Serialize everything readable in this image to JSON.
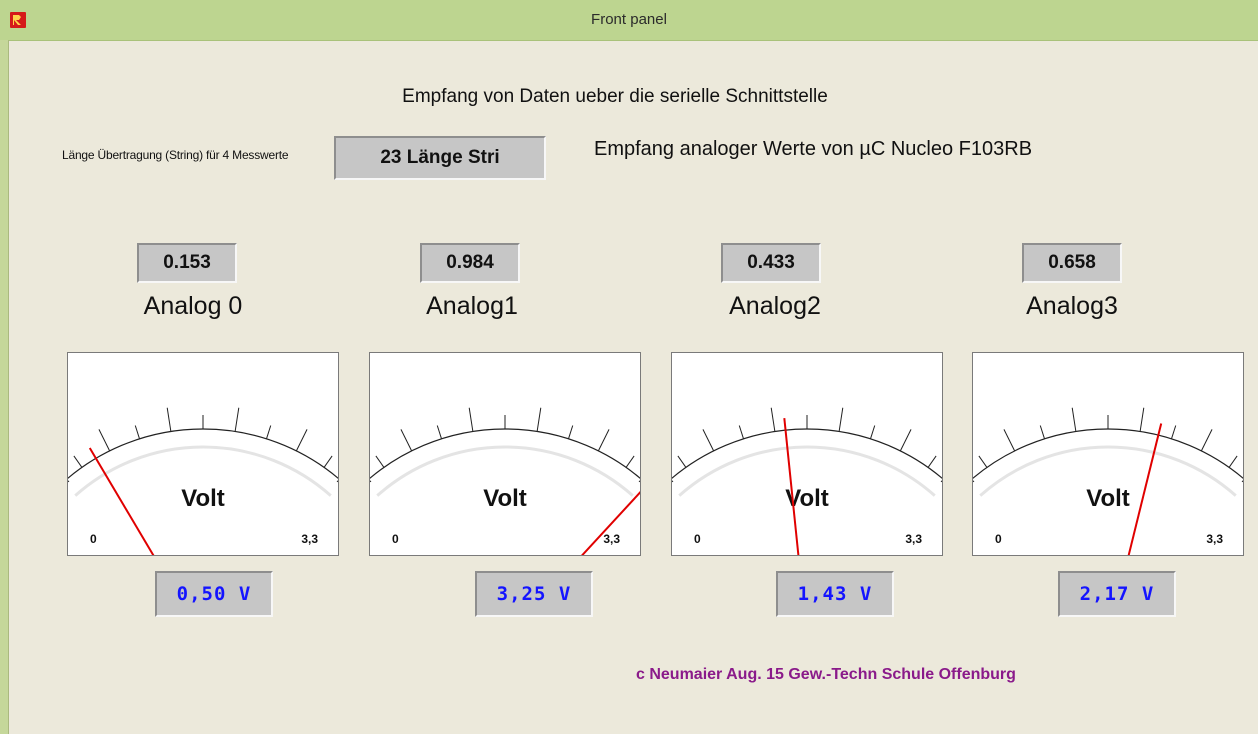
{
  "window": {
    "title": "Front panel",
    "icon": "labview-app-icon"
  },
  "panel": {
    "heading": "Empfang von Daten ueber die serielle Schnittstelle",
    "subheading": "Empfang analoger Werte von µC Nucleo F103RB",
    "length_label": "Länge Übertragung (String) für 4 Messwerte",
    "length_value": "23  Länge Stri",
    "credit": "c Neumaier Aug. 15   Gew.-Techn Schule Offenburg"
  },
  "channels": [
    {
      "label": "Analog 0",
      "raw": "0.153",
      "volt": "0,50  V",
      "voltage": 0.5
    },
    {
      "label": "Analog1",
      "raw": "0.984",
      "volt": "3,25  V",
      "voltage": 3.25
    },
    {
      "label": "Analog2",
      "raw": "0.433",
      "volt": "1,43  V",
      "voltage": 1.43
    },
    {
      "label": "Analog3",
      "raw": "0.658",
      "volt": "2,17  V",
      "voltage": 2.17
    }
  ],
  "meter": {
    "unit": "Volt",
    "min_label": "0",
    "max_label": "3,3",
    "min": 0,
    "max": 3.3,
    "major_ticks": 6,
    "needle_color": "#e00000"
  },
  "colors": {
    "titlebar": "#bdd590",
    "panel_bg": "#ece9db",
    "volt_text": "#1414ff",
    "credit": "#8a1a8a"
  }
}
